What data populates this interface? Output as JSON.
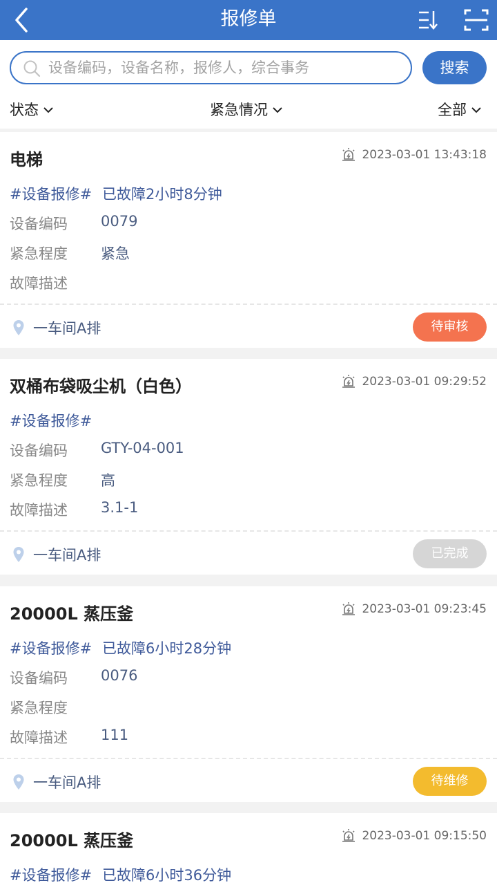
{
  "header": {
    "title": "报修单"
  },
  "search": {
    "placeholder": "设备编码，设备名称，报修人，综合事务",
    "button_label": "搜索"
  },
  "filters": {
    "status": "状态",
    "urgency": "紧急情况",
    "range": "全部"
  },
  "fields": {
    "code_label": "设备编码",
    "urgency_label": "紧急程度",
    "desc_label": "故障描述"
  },
  "cards": [
    {
      "name": "电梯",
      "time": "2023-03-01 13:43:18",
      "tag": "#设备报修#",
      "duration": "已故障2小时8分钟",
      "code": "0079",
      "urgency": "紧急",
      "desc": "",
      "location": "一车间A排",
      "status": "待审核",
      "status_color": "#f4734f"
    },
    {
      "name": "双桶布袋吸尘机（白色）",
      "time": "2023-03-01 09:29:52",
      "tag": "#设备报修#",
      "duration": "",
      "code": "GTY-04-001",
      "urgency": "高",
      "desc": "3.1-1",
      "location": "一车间A排",
      "status": "已完成",
      "status_color": "#d6d6d6"
    },
    {
      "name": "20000L 蒸压釜",
      "time": "2023-03-01 09:23:45",
      "tag": "#设备报修#",
      "duration": "已故障6小时28分钟",
      "code": "0076",
      "urgency": "",
      "desc": "111",
      "location": "一车间A排",
      "status": "待维修",
      "status_color": "#f3bb2e"
    },
    {
      "name": "20000L 蒸压釜",
      "time": "2023-03-01 09:15:50",
      "tag": "#设备报修#",
      "duration": "已故障6小时36分钟"
    }
  ],
  "colors": {
    "primary": "#3a74c8",
    "pending_review": "#f4734f",
    "completed": "#d6d6d6",
    "pending_repair": "#f3bb2e"
  },
  "icons": [
    "back-icon",
    "sort-icon",
    "scan-icon",
    "search-icon",
    "chevron-down-icon",
    "alarm-icon",
    "location-pin-icon"
  ]
}
